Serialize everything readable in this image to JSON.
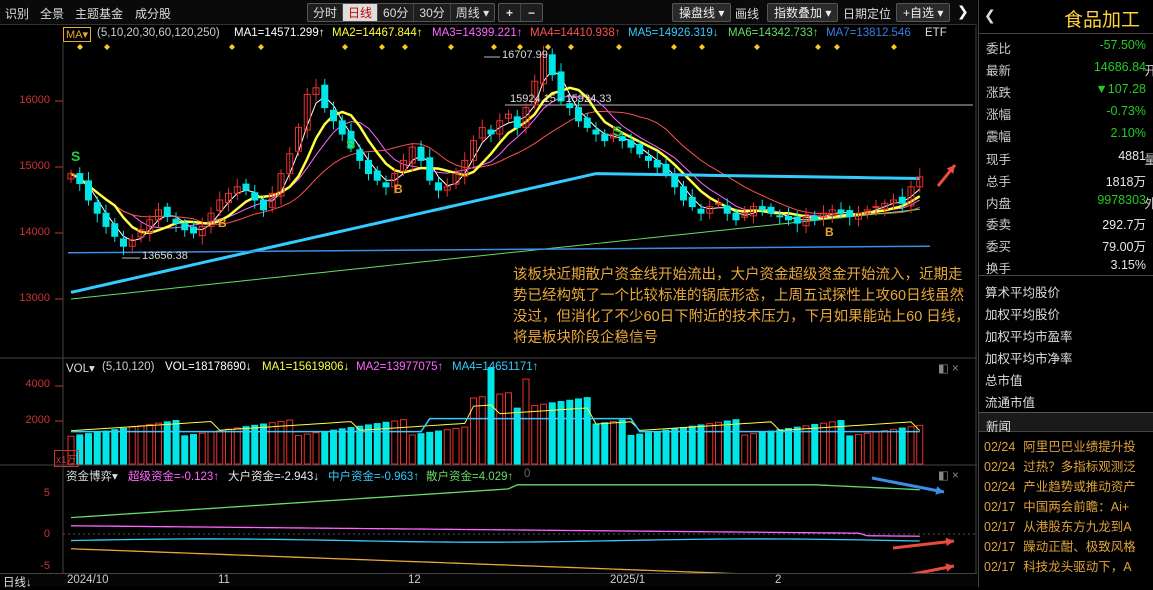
{
  "nav": {
    "items": [
      "识别",
      "全景",
      "主题基金",
      "成分股"
    ]
  },
  "period": {
    "tabs": [
      "分时",
      "日线",
      "60分",
      "30分",
      "周线 ▾"
    ],
    "active": "日线"
  },
  "zoom": {
    "plus": "+",
    "minus": "−"
  },
  "toolbar": {
    "items": [
      "操盘线 ▾",
      "画线",
      "指数叠加 ▾",
      "日期定位",
      "+自选 ▾"
    ],
    "close": "❯"
  },
  "ma_line": {
    "selector": "MA▾",
    "params": "(5,10,20,30,60,120,250)",
    "ma1": "MA1=14571.299↑",
    "ma2": "MA2=14467.844↑",
    "ma3": "MA3=14399.221↑",
    "ma4": "MA4=14410.938↑",
    "ma5": "MA5=14926.319↓",
    "ma6": "MA6=14342.733↑",
    "ma7": "MA7=13812.546",
    "etf": "ETF"
  },
  "price_axis": [
    "16000",
    "15000",
    "14000",
    "13000"
  ],
  "price_notes": {
    "high": "16707.99",
    "range": "15924.15 - 15924.33",
    "low": "13656.38"
  },
  "signals": {
    "s1": "S",
    "s2": "S",
    "s3": "S",
    "b1": "B",
    "b2": "B",
    "b3": "B"
  },
  "vol_line": {
    "selector": "VOL▾",
    "params": "(5,10,120)",
    "vol": "VOL=18178690↓",
    "ma1": "MA1=15619806↓",
    "ma2": "MA2=13977075↑",
    "ma4": "MA4=14651171↑",
    "close": "◧ ×"
  },
  "vol_axis": [
    "4000",
    "2000"
  ],
  "vol_unit": "x1万",
  "fund_line": {
    "selector": "资金博弈▾",
    "super": "超级资金=-0.123↑",
    "large": "大户资金=-2.943↓",
    "mid": "中户资金=-0.963↑",
    "retail": "散户资金=4.029↑",
    "zero": "0",
    "close": "◧ ×"
  },
  "fund_axis": [
    "5",
    "0",
    "-5"
  ],
  "dates": {
    "label": "日线↓",
    "ticks": [
      "2024/10",
      "11",
      "12",
      "2025/1",
      "2"
    ]
  },
  "annotation": "该板块近期散户资金线开始流出，大户资金超级资金开始流入，近期走势已经构筑了一个比较标准的锅底形态，上周五试探性上攻60日线虽然没过，但消化了不少60日下附近的技术压力，下月如果能站上60 日线，将是板块阶段企稳信号",
  "panel": {
    "title": "食品加工",
    "rows": [
      {
        "label": "委比",
        "value": "-57.50%",
        "color": "#22cc22"
      },
      {
        "label": "最新",
        "value": "14686.84",
        "color": "#22cc22"
      },
      {
        "label": "涨跌",
        "value": "▼107.28",
        "color": "#22cc22"
      },
      {
        "label": "涨幅",
        "value": "-0.73%",
        "color": "#22cc22"
      },
      {
        "label": "震幅",
        "value": "2.10%",
        "color": "#22cc22"
      },
      {
        "label": "现手",
        "value": "4881",
        "color": "#e8e8e8"
      },
      {
        "label": "总手",
        "value": "1818万",
        "color": "#e8e8e8"
      },
      {
        "label": "内盘",
        "value": "9978303",
        "color": "#22cc22"
      },
      {
        "label": "委卖",
        "value": "292.7万",
        "color": "#e8e8e8"
      },
      {
        "label": "委买",
        "value": "79.00万",
        "color": "#e8e8e8"
      },
      {
        "label": "换手",
        "value": "3.15%",
        "color": "#e8e8e8"
      }
    ],
    "edge": [
      "开",
      "量",
      "外"
    ],
    "avg": [
      "算术平均股价",
      "加权平均股价",
      "加权平均市盈率",
      "加权平均市净率",
      "总市值",
      "流通市值"
    ],
    "news_header": "新闻",
    "news": [
      {
        "date": "02/24",
        "title": "阿里巴巴业绩提升投"
      },
      {
        "date": "02/24",
        "title": "过热？多指标观测泛"
      },
      {
        "date": "02/24",
        "title": "产业趋势或推动资产"
      },
      {
        "date": "02/17",
        "title": "中国两会前瞻：Ai+"
      },
      {
        "date": "02/17",
        "title": "从港股东方九龙到A"
      },
      {
        "date": "02/17",
        "title": "躁动正酣、极致风格"
      },
      {
        "date": "02/17",
        "title": "科技龙头驱动下，A"
      }
    ]
  },
  "colors": {
    "up": "#e83030",
    "down": "#00e5e5",
    "ma5": "#ffff40",
    "ma60": "#33ccff",
    "arrow": "#e84c3d",
    "blue": "#3a8ee6"
  }
}
